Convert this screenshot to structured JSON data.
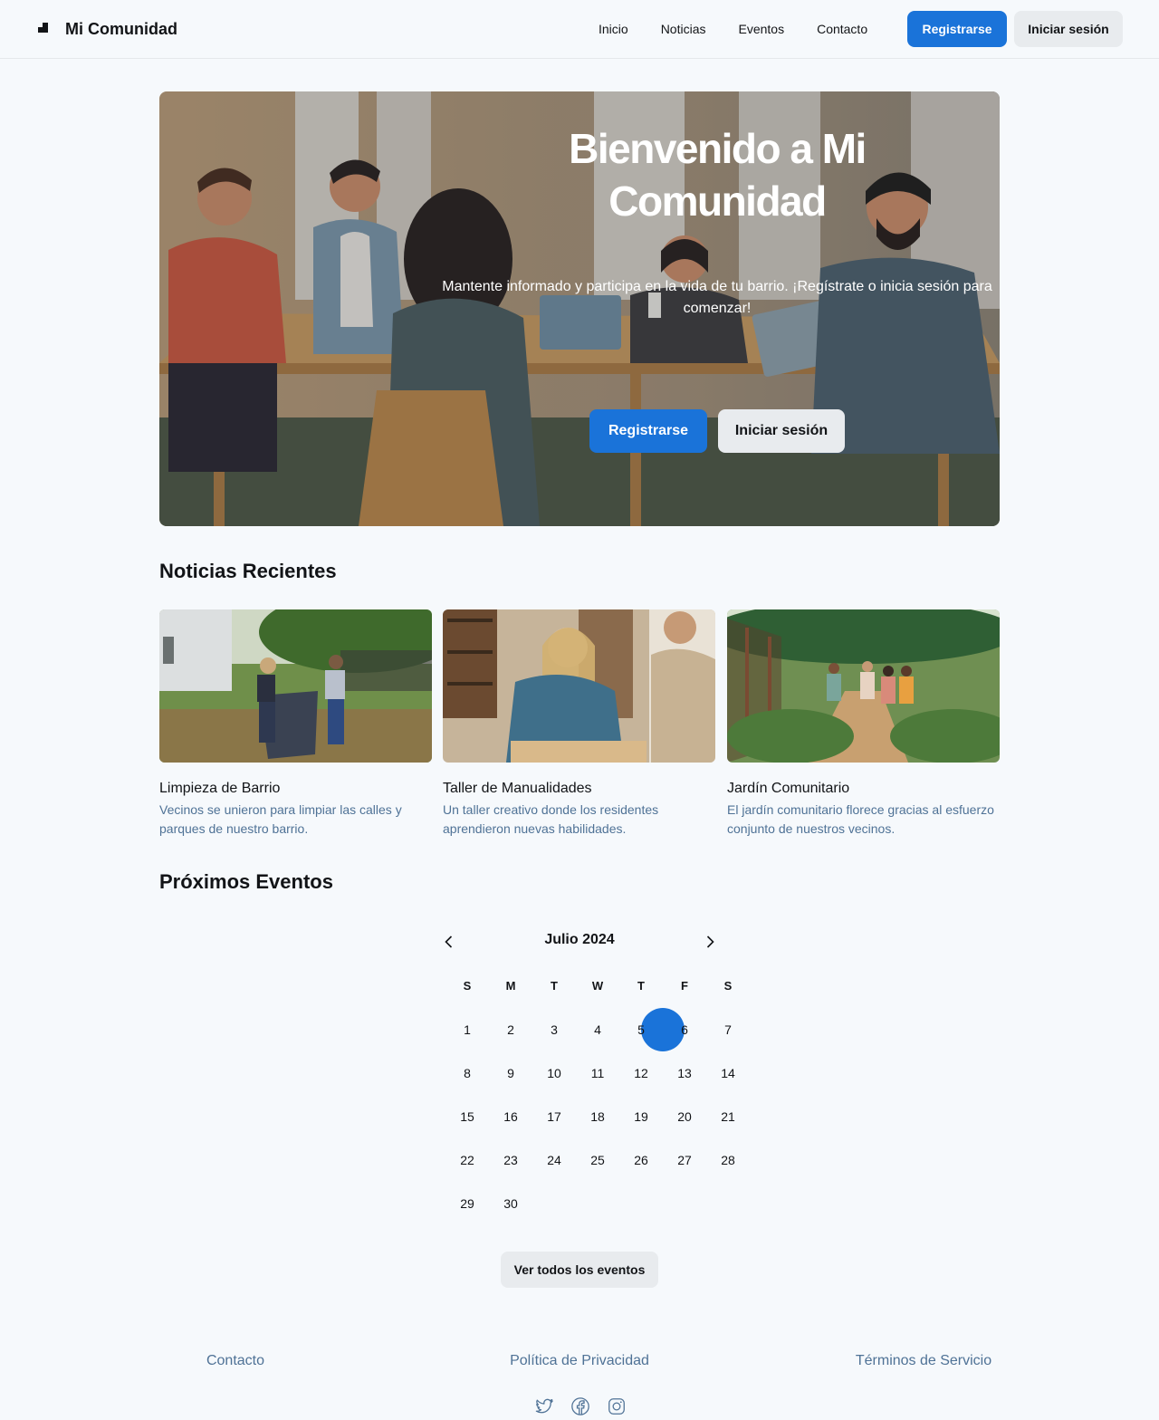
{
  "header": {
    "brand": "Mi Comunidad",
    "nav": [
      "Inicio",
      "Noticias",
      "Eventos",
      "Contacto"
    ],
    "register": "Registrarse",
    "login": "Iniciar sesión"
  },
  "hero": {
    "title": "Bienvenido a Mi Comunidad",
    "subtitle": "Mantente informado y participa en la vida de tu barrio. ¡Regístrate o inicia sesión para comenzar!",
    "register": "Registrarse",
    "login": "Iniciar sesión"
  },
  "news": {
    "title": "Noticias Recientes",
    "items": [
      {
        "title": "Limpieza de Barrio",
        "desc": "Vecinos se unieron para limpiar las calles y parques de nuestro barrio."
      },
      {
        "title": "Taller de Manualidades",
        "desc": "Un taller creativo donde los residentes aprendieron nuevas habilidades."
      },
      {
        "title": "Jardín Comunitario",
        "desc": "El jardín comunitario florece gracias al esfuerzo conjunto de nuestros vecinos."
      }
    ]
  },
  "events": {
    "title": "Próximos Eventos",
    "month": "Julio 2024",
    "weekdays": [
      "S",
      "M",
      "T",
      "W",
      "T",
      "F",
      "S"
    ],
    "days": [
      "1",
      "2",
      "3",
      "4",
      "5",
      "6",
      "7",
      "8",
      "9",
      "10",
      "11",
      "12",
      "13",
      "14",
      "15",
      "16",
      "17",
      "18",
      "19",
      "20",
      "21",
      "22",
      "23",
      "24",
      "25",
      "26",
      "27",
      "28",
      "29",
      "30"
    ],
    "selected_day": "5",
    "view_all": "Ver todos los eventos"
  },
  "footer": {
    "links": [
      "Contacto",
      "Política de Privacidad",
      "Términos de Servicio"
    ],
    "social": [
      "twitter-icon",
      "facebook-icon",
      "instagram-icon"
    ]
  },
  "colors": {
    "primary": "#1a73d9",
    "secondary_btn": "#e8ebee",
    "background": "#f6f9fc",
    "muted_text": "#4f7296"
  }
}
